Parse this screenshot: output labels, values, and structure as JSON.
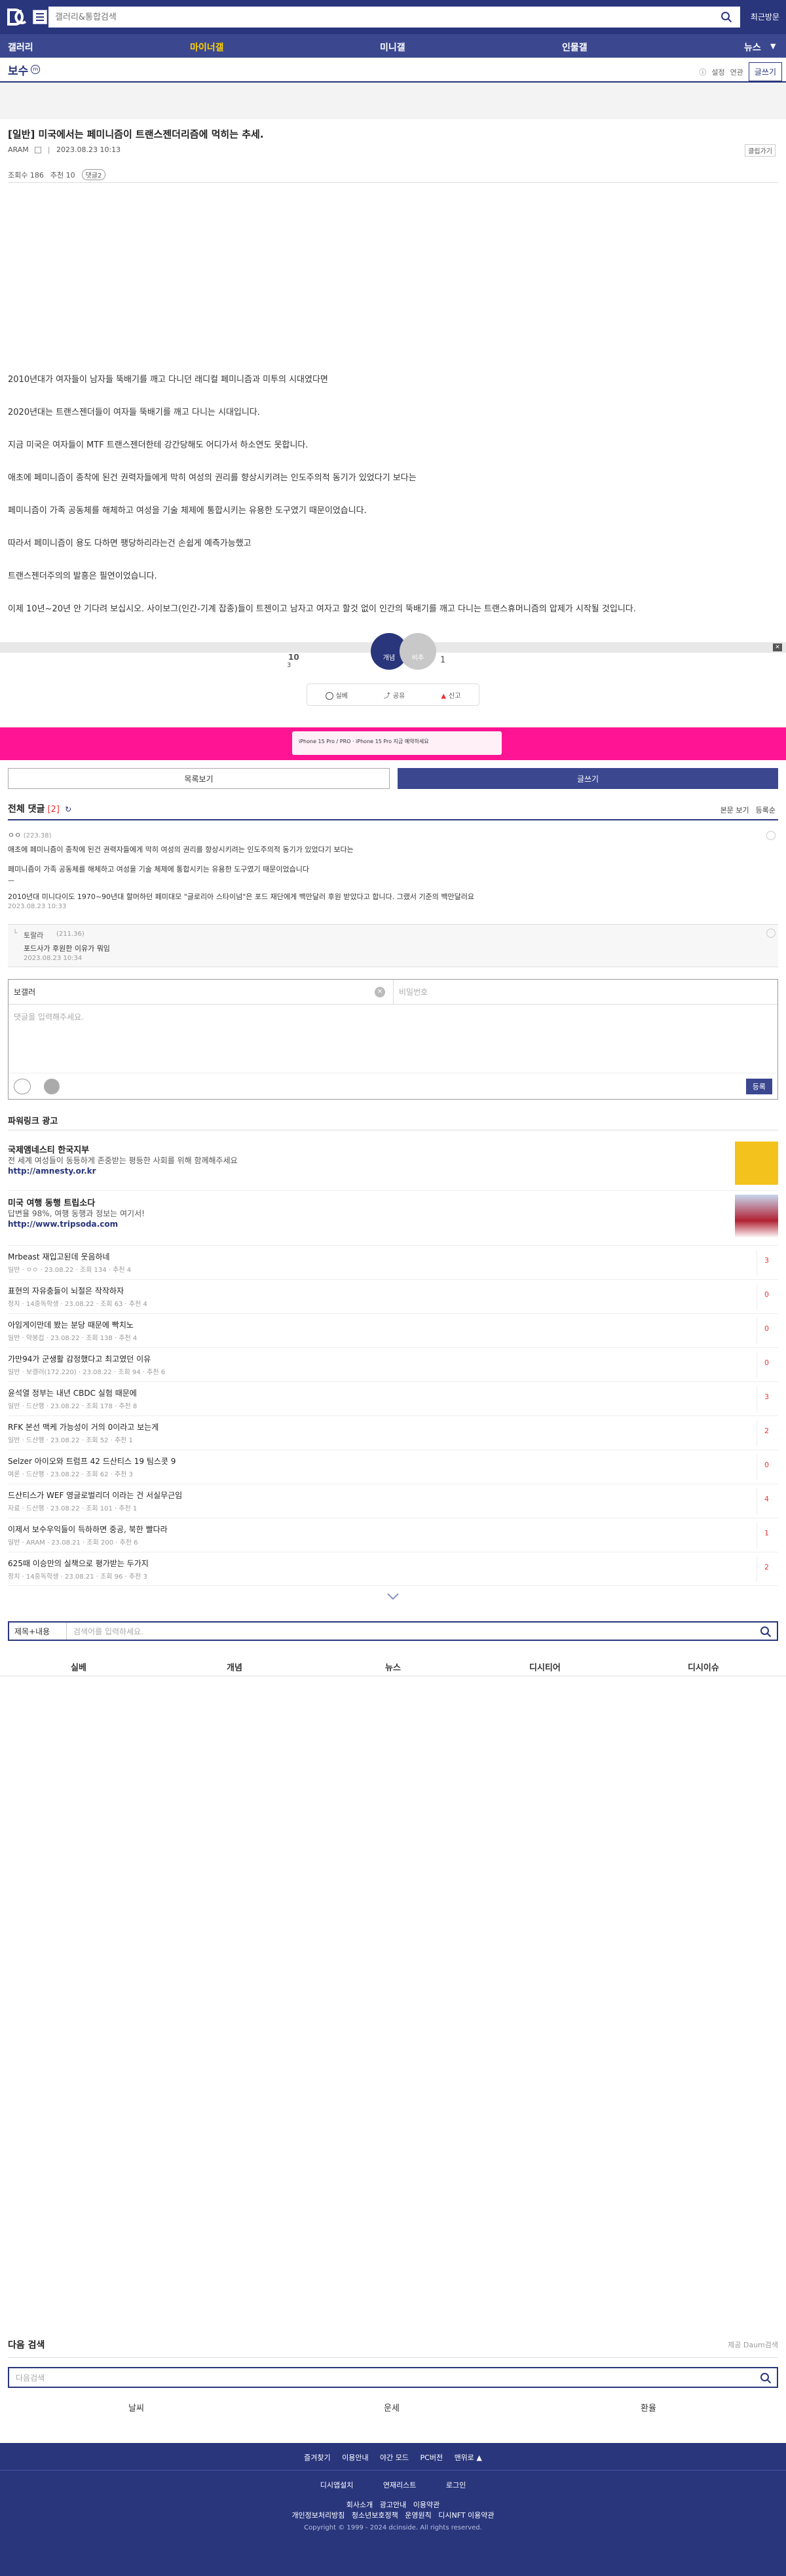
{
  "header": {
    "search_placeholder": "갤러리&통합검색",
    "recent_label": "최근방문"
  },
  "nav": {
    "items": [
      "갤러리",
      "마이너갤",
      "미니갤",
      "인물갤",
      "뉴스"
    ],
    "active_index": 1,
    "dropdown_arrow": "▼"
  },
  "gallery": {
    "title": "보수",
    "badge": "m",
    "info_label": "ⓘ",
    "setting_label": "설정",
    "dark_label": "연관",
    "write_label": "글쓰기"
  },
  "post": {
    "title": "[일반] 미국에서는 페미니즘이 트랜스젠더리즘에 먹히는 추세.",
    "author": "ARAM",
    "date": "2023.08.23 10:13",
    "clip_label": "클립가기",
    "views_label": "조회수 186",
    "recommend_label": "추천 10",
    "comment_tag": "댓글2",
    "body": [
      "2010년대가 여자들이 남자들 뚝배기를 깨고 다니던 래디컬 페미니즘과 미투의 시대였다면",
      "2020년대는 트랜스젠더들이 여자들 뚝배기를 깨고 다니는 시대입니다.",
      "지금 미국은 여자들이 MTF 트랜스젠더한테 강간당해도 어디가서 하소연도 못합니다.",
      "애초에 페미니즘이 종착에 된건 권력자들에게 막히 여성의 권리를 향상시키려는 인도주의적 동기가 있었다기 보다는",
      "페미니즘이 가족 공동체를 해체하고 여성을 기술 체제에 통합시키는 유용한 도구였기 때문이었습니다.",
      "따라서 페미니즘이 용도 다하면 팽당하리라는건 손쉽게 예측가능했고",
      "트랜스젠더주의의 발흥은 필연이었습니다.",
      "이제 10년~20년 안 기다려 보십시오. 사이보그(인간-기계 잡종)들이 트젠이고 남자고 여자고 할것 없이 인간의 뚝배기를 깨고 다니는 트랜스휴머니즘의 압제가 시작될 것입니다."
    ],
    "recommend_count": "10",
    "recommend_sub": "3",
    "recommend_btn": "개념",
    "unrecommend_btn": "비추",
    "unrecommend_count": "1",
    "share_items": [
      "실베",
      "공유",
      "신고"
    ]
  },
  "ad": {
    "pink_text": "iPhone 15 Pro / PRO · iPhone 15 Pro 지금 예약하세요"
  },
  "buttons": {
    "list_label": "목록보기",
    "write_label": "글쓰기"
  },
  "comments": {
    "title": "전체 댓글",
    "count": "[2]",
    "view_original": "본문 보기",
    "sort_label": "등록순",
    "items": [
      {
        "author": "ㅇㅇ",
        "ip": "(223.38)",
        "lines": [
          "애초에 페미니즘이 종착에 된건 권력자들에게 막히 여성의 권리를 향상시키려는 인도주의적 동기가 있었다기 보다는",
          "페미니즘이 가족 공동체를 해체하고 여성을 기술 체제에 통합시키는 유용한 도구였기 때문이었습니다",
          "ㅡ",
          "2010년대 미니다이도 1970~90년대 할머하던 페미대모 \"글로리아 스타이넘\"은 포드 재단에게 백만달러 후원 받았다고 합니다. 그랬서 기준의 백만달러요"
        ],
        "date": "2023.08.23 10:33"
      },
      {
        "author": "토랄라",
        "ip": "(211.36)",
        "lines": [
          "포드사가 후원한 이유가 뭐임"
        ],
        "date": "2023.08.23 10:34"
      }
    ]
  },
  "comment_box": {
    "name_value": "보갤러",
    "password_placeholder": "비밀번호",
    "text_placeholder": "댓글을 입력해주세요.",
    "submit_label": "등록"
  },
  "powerlink": {
    "title": "파워링크 광고",
    "items": [
      {
        "name": "국제앰네스티 한국지부",
        "desc": "전 세계 여성들이 동등하게 존중받는 평등한 사회를 위해 함께해주세요",
        "url": "http://amnesty.or.kr"
      },
      {
        "name": "미국 여행 동행 트립소다",
        "desc": "답변율 98%, 여행 동행과 정보는 여기서!",
        "url": "http://www.tripsoda.com"
      }
    ]
  },
  "post_list": [
    {
      "title": "Mrbeast 재입고된데 웃음하네",
      "meta": "일반 · ㅇㅇ · 23.08.22 · 조회 134 · 추천 4",
      "count": "3"
    },
    {
      "title": "표현의 자유충들이 뇌절은 작작하자",
      "meta": "정치 · 14중독학생 · 23.08.22 · 조회 63 · 추천 4",
      "count": "0"
    },
    {
      "title": "아임게이만데 봤는 분당 때문에 빡치노",
      "meta": "일반 · 약봉컵 · 23.08.22 · 조회 138 · 추천 4",
      "count": "0"
    },
    {
      "title": "가만94가 군생활 감정했다고 최고였던 이유",
      "meta": "일반 · 보갤러(172.220) · 23.08.22 · 조회 94 · 추천 6",
      "count": "0"
    },
    {
      "title": "윤석열 정부는 내년 CBDC 실험 때문에",
      "meta": "일반 · 드산행 · 23.08.22 · 조회 178 · 추천 8",
      "count": "3"
    },
    {
      "title": "RFK 본선 맥케 가능성이 거의 0이라고 보는게",
      "meta": "일반 · 드산행 · 23.08.22 · 조회 52 · 추천 1",
      "count": "2"
    },
    {
      "title": "Selzer 아이오와 트럼프 42 드산티스 19 팀스콧 9",
      "meta": "여론 · 드산행 · 23.08.22 · 조회 62 · 추천 3",
      "count": "0"
    },
    {
      "title": "드산티스가 WEF 영글로벌리더 이라는 건 서실무근임",
      "meta": "자료 · 드산행 · 23.08.22 · 조회 101 · 추천 1",
      "count": "4"
    },
    {
      "title": "이제서 보수우익들이 득하하면 중공, 북한 빨다라",
      "meta": "일반 · ARAM · 23.08.21 · 조회 200 · 추천 6",
      "count": "1"
    },
    {
      "title": "625때 이승만의 실책으로 평가받는 두가지",
      "meta": "정치 · 14중독학생 · 23.08.21 · 조회 96 · 추천 3",
      "count": "2"
    }
  ],
  "bottom_search": {
    "select_label": "제목+내용",
    "placeholder": "검색어를 입력하세요."
  },
  "categories": [
    "실베",
    "개념",
    "뉴스",
    "디시티어",
    "디시이슈"
  ],
  "daum": {
    "title": "다음 검색",
    "right_label": "제공 Daum검색",
    "placeholder": "다음검색",
    "links": [
      "날씨",
      "운세",
      "환율"
    ]
  },
  "footer": {
    "row1": [
      "즐겨찾기",
      "이용안내",
      "야간 모드",
      "PC버전",
      "맨위로 ▲"
    ],
    "row2": [
      "디시앱설치",
      "연재리스트",
      "로그인"
    ],
    "row3": [
      "회사소개",
      "광고안내",
      "이용약관"
    ],
    "row4": [
      "개인정보처리방침",
      "청소년보호정책",
      "운영원칙",
      "디시NFT 이용약관"
    ],
    "copyright": "Copyright © 1999 - 2024 dcinside. All rights reserved."
  },
  "colors": {
    "brand": "#29367c",
    "accent": "#ffd200",
    "ad_pink": "#ff1493",
    "count_red": "#e33333"
  }
}
